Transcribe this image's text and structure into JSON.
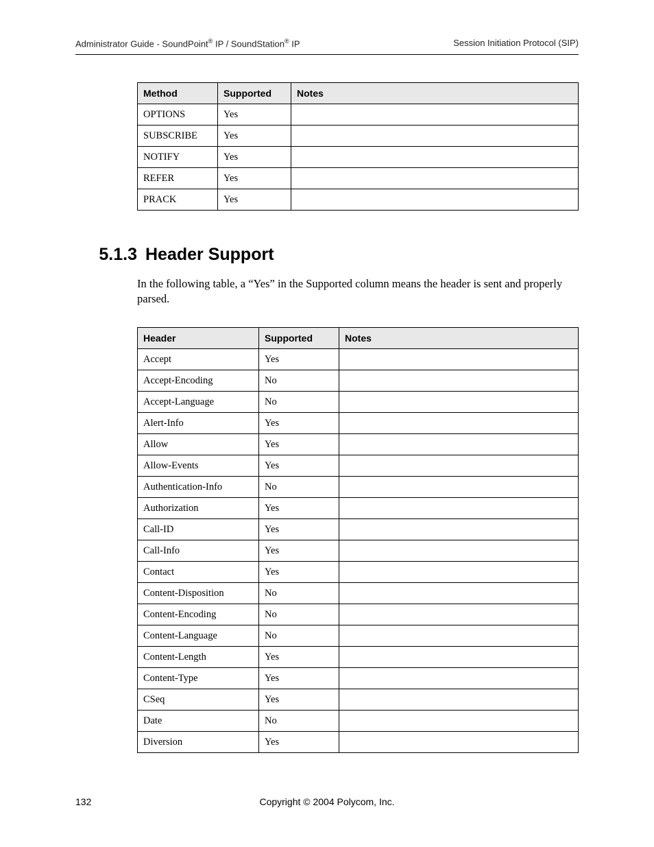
{
  "header": {
    "left_pre": "Administrator Guide - SoundPoint",
    "left_mid": " IP / SoundStation",
    "left_post": " IP",
    "right": "Session Initiation Protocol (SIP)"
  },
  "table1": {
    "cols": [
      "Method",
      "Supported",
      "Notes"
    ],
    "rows": [
      [
        "OPTIONS",
        "Yes",
        ""
      ],
      [
        "SUBSCRIBE",
        "Yes",
        ""
      ],
      [
        "NOTIFY",
        "Yes",
        ""
      ],
      [
        "REFER",
        "Yes",
        ""
      ],
      [
        "PRACK",
        "Yes",
        ""
      ]
    ]
  },
  "section": {
    "num": "5.1.3",
    "title": "Header Support",
    "para": "In the following table, a “Yes” in the Supported column means the header is sent and properly parsed."
  },
  "table2": {
    "cols": [
      "Header",
      "Supported",
      "Notes"
    ],
    "rows": [
      [
        "Accept",
        "Yes",
        ""
      ],
      [
        "Accept-Encoding",
        "No",
        ""
      ],
      [
        "Accept-Language",
        "No",
        ""
      ],
      [
        "Alert-Info",
        "Yes",
        ""
      ],
      [
        "Allow",
        "Yes",
        ""
      ],
      [
        "Allow-Events",
        "Yes",
        ""
      ],
      [
        "Authentication-Info",
        "No",
        ""
      ],
      [
        "Authorization",
        "Yes",
        ""
      ],
      [
        "Call-ID",
        "Yes",
        ""
      ],
      [
        "Call-Info",
        "Yes",
        ""
      ],
      [
        "Contact",
        "Yes",
        ""
      ],
      [
        "Content-Disposition",
        "No",
        ""
      ],
      [
        "Content-Encoding",
        "No",
        ""
      ],
      [
        "Content-Language",
        "No",
        ""
      ],
      [
        "Content-Length",
        "Yes",
        ""
      ],
      [
        "Content-Type",
        "Yes",
        ""
      ],
      [
        "CSeq",
        "Yes",
        ""
      ],
      [
        "Date",
        "No",
        ""
      ],
      [
        "Diversion",
        "Yes",
        ""
      ]
    ]
  },
  "footer": {
    "page": "132",
    "copy": "Copyright © 2004 Polycom, Inc."
  }
}
